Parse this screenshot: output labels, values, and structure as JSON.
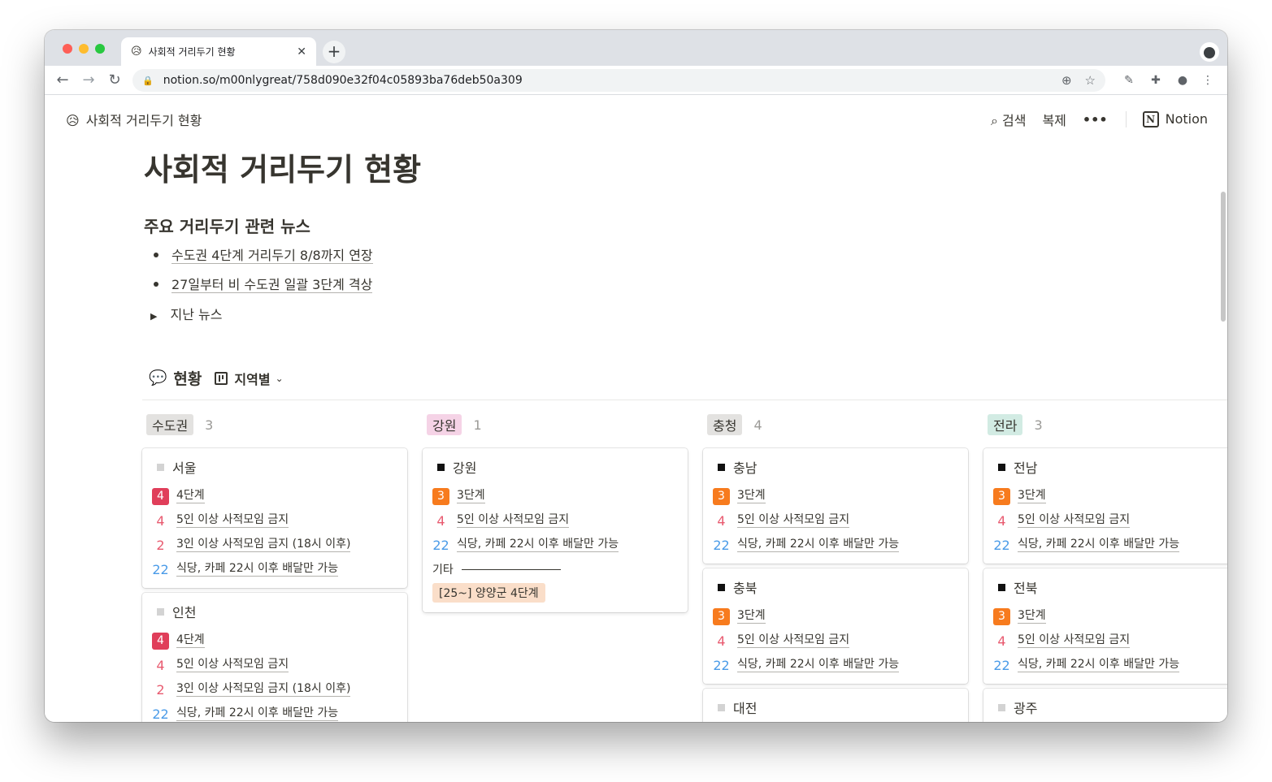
{
  "browser": {
    "tab_emoji": "😥",
    "tab_title": "사회적 거리두기 현황",
    "tab_close": "✕",
    "new_tab": "+",
    "lock": "🔒",
    "url": "notion.so/m00nlygreat/758d090e32f04c05893ba76deb50a309"
  },
  "notion": {
    "breadcrumb_emoji": "😥",
    "breadcrumb_title": "사회적 거리두기 현황",
    "search_label": "검색",
    "duplicate_label": "복제",
    "more_label": "•••",
    "notion_label": "Notion",
    "page_title": "사회적 거리두기 현황",
    "news_heading": "주요 거리두기 관련 뉴스",
    "news_links": [
      "수도권 4단계 거리두기 8/8까지 연장",
      "27일부터 비 수도권 일괄 3단계 격상"
    ],
    "past_news_toggle": "지난 뉴스",
    "db_emoji": "💬",
    "db_title": "현황",
    "view_name": "지역별"
  },
  "colors": {
    "level4": "#e03e5a",
    "level3": "#f77b1e",
    "num4": "#e85a6f",
    "num2": "#e85a6f",
    "num22": "#4a9be8",
    "tag_sudogwon": "#e3e2e0",
    "tag_gangwon": "#f5d3e6",
    "tag_chungcheong": "#e3e2e0",
    "tag_jeolla": "#d2ebe3"
  },
  "board": {
    "columns": [
      {
        "name": "수도권",
        "count": "3",
        "cards": [
          {
            "title": "서울",
            "level": "4",
            "level_label": "4단계",
            "rows": [
              {
                "num": "4",
                "text": "5인 이상 사적모임 금지"
              },
              {
                "num": "2",
                "text": "3인 이상 사적모임 금지 (18시 이후)"
              },
              {
                "num": "22",
                "text": "식당, 카페 22시 이후 배달만 가능"
              }
            ]
          },
          {
            "title": "인천",
            "level": "4",
            "level_label": "4단계",
            "rows": [
              {
                "num": "4",
                "text": "5인 이상 사적모임 금지"
              },
              {
                "num": "2",
                "text": "3인 이상 사적모임 금지 (18시 이후)"
              },
              {
                "num": "22",
                "text": "식당, 카페 22시 이후 배달만 가능"
              }
            ]
          }
        ]
      },
      {
        "name": "강원",
        "count": "1",
        "cards": [
          {
            "title": "강원",
            "level": "3",
            "level_label": "3단계",
            "rows": [
              {
                "num": "4",
                "text": "5인 이상 사적모임 금지"
              },
              {
                "num": "22",
                "text": "식당, 카페 22시 이후 배달만 가능"
              }
            ],
            "misc_label": "기타",
            "misc_tag": "[25~] 양양군 4단계"
          }
        ]
      },
      {
        "name": "충청",
        "count": "4",
        "cards": [
          {
            "title": "충남",
            "level": "3",
            "level_label": "3단계",
            "rows": [
              {
                "num": "4",
                "text": "5인 이상 사적모임 금지"
              },
              {
                "num": "22",
                "text": "식당, 카페 22시 이후 배달만 가능"
              }
            ]
          },
          {
            "title": "충북",
            "level": "3",
            "level_label": "3단계",
            "rows": [
              {
                "num": "4",
                "text": "5인 이상 사적모임 금지"
              },
              {
                "num": "22",
                "text": "식당, 카페 22시 이후 배달만 가능"
              }
            ]
          },
          {
            "title": "대전"
          }
        ]
      },
      {
        "name": "전라",
        "count": "3",
        "cards": [
          {
            "title": "전남",
            "level": "3",
            "level_label": "3단계",
            "rows": [
              {
                "num": "4",
                "text": "5인 이상 사적모임 금지"
              },
              {
                "num": "22",
                "text": "식당, 카페 22시 이후 배달만 가능"
              }
            ]
          },
          {
            "title": "전북",
            "level": "3",
            "level_label": "3단계",
            "rows": [
              {
                "num": "4",
                "text": "5인 이상 사적모임 금지"
              },
              {
                "num": "22",
                "text": "식당, 카페 22시 이후 배달만 가능"
              }
            ]
          },
          {
            "title": "광주"
          }
        ]
      }
    ]
  }
}
